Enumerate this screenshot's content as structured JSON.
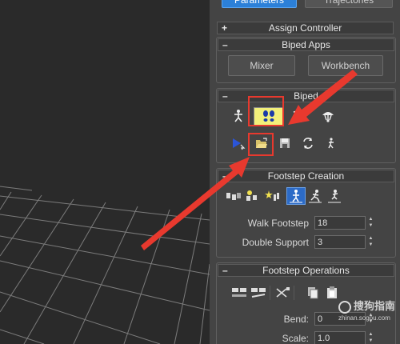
{
  "command_panel": {
    "top_tabs": [
      "Parameters",
      "Trajectories"
    ],
    "assign_controller": {
      "title": "Assign Controller",
      "toggle": "+"
    },
    "biped_apps": {
      "title": "Biped Apps",
      "toggle": "–",
      "buttons": [
        "Mixer",
        "Workbench"
      ]
    },
    "biped": {
      "title": "Biped",
      "toggle": "–",
      "mode_icons": [
        "figure-mode-icon",
        "footstep-mode-icon",
        "motion-flow-mode-icon",
        "mixer-mode-icon"
      ],
      "file_icons": [
        "playlist-icon",
        "load-file-icon",
        "save-file-icon",
        "convert-icon",
        "move-all-mode-icon"
      ]
    },
    "footstep_creation": {
      "title": "Footstep Creation",
      "toggle": "–",
      "icons": [
        "create-footsteps-append-icon",
        "create-footsteps-current-icon",
        "create-keys-icon",
        "walk-gait-icon",
        "run-gait-icon",
        "jump-gait-icon"
      ],
      "fields": [
        {
          "label": "Walk Footstep",
          "value": "18"
        },
        {
          "label": "Double Support",
          "value": "3"
        }
      ]
    },
    "footstep_operations": {
      "title": "Footstep Operations",
      "toggle": "–",
      "icons": [
        "activate-footsteps-icon",
        "deactivate-footsteps-icon",
        "bend-icon",
        "copy-footsteps-icon",
        "paste-footsteps-icon"
      ],
      "fields": [
        {
          "label": "Bend:",
          "value": "0"
        },
        {
          "label": "Scale:",
          "value": "1.0"
        }
      ]
    }
  },
  "watermark": {
    "text": "搜狗指南",
    "url": "zhinan.sogou.com"
  },
  "colors": {
    "highlight": "#e8392e",
    "active_tab": "#2c80d8",
    "footstep_active": "#f2f07a"
  }
}
